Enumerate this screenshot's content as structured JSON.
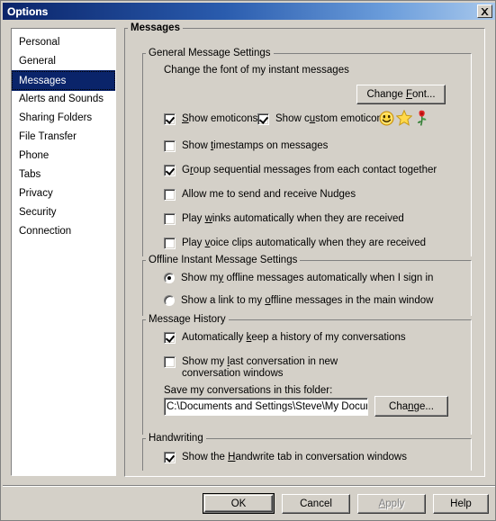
{
  "window": {
    "title": "Options",
    "close_label": "Close"
  },
  "sidebar": {
    "items": [
      {
        "label": "Personal",
        "selected": false
      },
      {
        "label": "General",
        "selected": false
      },
      {
        "label": "Messages",
        "selected": true
      },
      {
        "label": "Alerts and Sounds",
        "selected": false
      },
      {
        "label": "Sharing Folders",
        "selected": false
      },
      {
        "label": "File Transfer",
        "selected": false
      },
      {
        "label": "Phone",
        "selected": false
      },
      {
        "label": "Tabs",
        "selected": false
      },
      {
        "label": "Privacy",
        "selected": false
      },
      {
        "label": "Security",
        "selected": false
      },
      {
        "label": "Connection",
        "selected": false
      }
    ]
  },
  "panel": {
    "title": "Messages",
    "groups": {
      "general": {
        "title": "General Message Settings",
        "font_label": "Change the font of my instant messages",
        "change_font_button": "Change Font...",
        "show_emoticons": "Show emoticons",
        "show_custom_emoticons": "Show custom emoticons",
        "show_timestamps": "Show timestamps on messages",
        "group_sequential": "Group sequential messages from each contact together",
        "allow_nudges": "Allow me to send and receive Nudges",
        "play_winks": "Play winks automatically when they are received",
        "play_voice_clips": "Play voice clips automatically when they are received"
      },
      "offline": {
        "title": "Offline Instant Message Settings",
        "option_show_automatically": "Show my offline messages automatically when I sign in",
        "option_show_link": "Show a link to my offline messages in the main window"
      },
      "history": {
        "title": "Message History",
        "auto_keep": "Automatically keep a history of my conversations",
        "show_last_line1": "Show my last conversation in new",
        "show_last_line2": "conversation windows",
        "save_folder_label": "Save my conversations in this folder:",
        "folder_path": "C:\\Documents and Settings\\Steve\\My Documi",
        "change_button": "Change..."
      },
      "handwriting": {
        "title": "Handwriting",
        "show_handwrite_tab": "Show the Handwrite tab in conversation windows"
      }
    }
  },
  "footer": {
    "ok": "OK",
    "cancel": "Cancel",
    "apply": "Apply",
    "help": "Help"
  },
  "icons": {
    "smiley": "smiley-emoticon-icon",
    "star": "star-emoticon-icon",
    "rose": "rose-emoticon-icon",
    "close": "close-icon"
  },
  "colors": {
    "titlebar_start": "#0a246a",
    "titlebar_end": "#a8c8ec",
    "selection": "#0a246a",
    "face": "#d4d0c8"
  }
}
